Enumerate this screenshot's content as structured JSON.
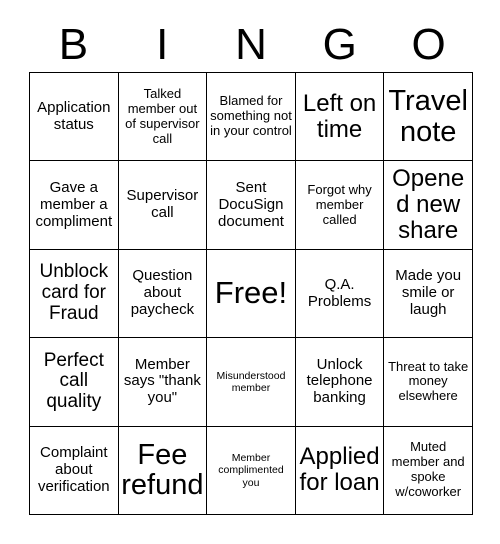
{
  "card": {
    "title": "BINGO",
    "header_letters": [
      "B",
      "I",
      "N",
      "G",
      "O"
    ],
    "free_space_label": "Free!",
    "columns": 5,
    "rows": 5,
    "colors": {
      "background": "#ffffff",
      "text": "#000000",
      "grid_line": "#000000"
    },
    "cells": [
      {
        "text": "Application status",
        "size": "m",
        "free": false
      },
      {
        "text": "Talked member out of supervisor call",
        "size": "s",
        "free": false
      },
      {
        "text": "Blamed for something not in your control",
        "size": "s",
        "free": false
      },
      {
        "text": "Left on time",
        "size": "xl",
        "free": false
      },
      {
        "text": "Travel note",
        "size": "xxl",
        "free": false
      },
      {
        "text": "Gave a member a compliment",
        "size": "m",
        "free": false
      },
      {
        "text": "Supervisor call",
        "size": "m",
        "free": false
      },
      {
        "text": "Sent DocuSign document",
        "size": "m",
        "free": false
      },
      {
        "text": "Forgot why member called",
        "size": "s",
        "free": false
      },
      {
        "text": "Opened new share",
        "size": "xl",
        "free": false
      },
      {
        "text": "Unblock card for Fraud",
        "size": "l",
        "free": false
      },
      {
        "text": "Question about paycheck",
        "size": "m",
        "free": false
      },
      {
        "text": "Free!",
        "size": "free",
        "free": true
      },
      {
        "text": "Q.A. Problems",
        "size": "m",
        "free": false
      },
      {
        "text": "Made you smile or laugh",
        "size": "m",
        "free": false
      },
      {
        "text": "Perfect call quality",
        "size": "l",
        "free": false
      },
      {
        "text": "Member says \"thank you\"",
        "size": "m",
        "free": false
      },
      {
        "text": "Misunderstood member",
        "size": "xs",
        "free": false
      },
      {
        "text": "Unlock telephone banking",
        "size": "m",
        "free": false
      },
      {
        "text": "Threat to take money elsewhere",
        "size": "s",
        "free": false
      },
      {
        "text": "Complaint about verification",
        "size": "m",
        "free": false
      },
      {
        "text": "Fee refund",
        "size": "xxl",
        "free": false
      },
      {
        "text": "Member complimented you",
        "size": "xs",
        "free": false
      },
      {
        "text": "Applied for loan",
        "size": "xl",
        "free": false
      },
      {
        "text": "Muted member and spoke w/coworker",
        "size": "s",
        "free": false
      }
    ]
  }
}
